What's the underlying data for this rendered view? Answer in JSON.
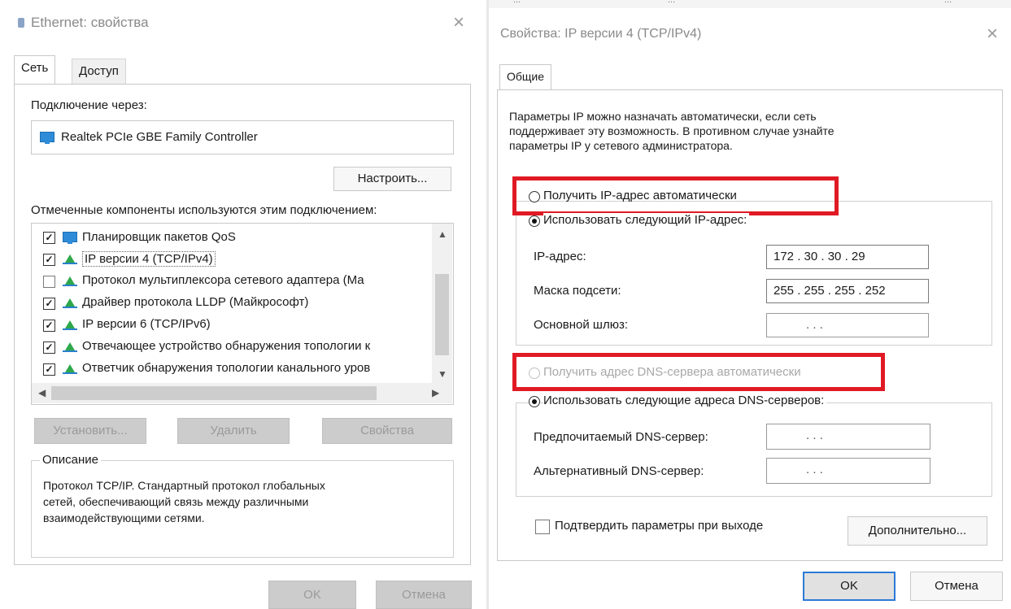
{
  "top_strip": {
    "items": [
      "...",
      "...",
      "..."
    ]
  },
  "left_dialog": {
    "title": "Ethernet: свойства",
    "close": "×",
    "tabs": [
      {
        "label": "Сеть",
        "active": true
      },
      {
        "label": "Доступ",
        "active": false
      }
    ],
    "connect_via_label": "Подключение через:",
    "adapter_name": "Realtek PCIe GBE Family Controller",
    "configure_button": "Настроить...",
    "components_label": "Отмеченные компоненты используются этим подключением:",
    "components": [
      {
        "label": "Планировщик пакетов QoS",
        "checked": true,
        "icon": "network-icon"
      },
      {
        "label": "IP версии 4 (TCP/IPv4)",
        "checked": true,
        "icon": "protocol-icon"
      },
      {
        "label": "Протокол мультиплексора сетевого адаптера (Ма",
        "checked": false,
        "icon": "protocol-icon"
      },
      {
        "label": "Драйвер протокола LLDP (Майкрософт)",
        "checked": true,
        "icon": "protocol-icon"
      },
      {
        "label": "IP версии 6 (TCP/IPv6)",
        "checked": true,
        "icon": "protocol-icon"
      },
      {
        "label": "Отвечающее устройство обнаружения топологии к",
        "checked": true,
        "icon": "protocol-icon"
      },
      {
        "label": "Ответчик обнаружения топологии канального уров",
        "checked": true,
        "icon": "protocol-icon"
      }
    ],
    "install_button": "Установить...",
    "remove_button": "Удалить",
    "properties_button": "Свойства",
    "description_legend": "Описание",
    "description_text_1": "Протокол TCP/IP. Стандартный протокол глобальных",
    "description_text_2": "сетей, обеспечивающий связь между различными",
    "description_text_3": "взаимодействующими сетями.",
    "ok_button": "OK",
    "cancel_button": "Отмена"
  },
  "right_dialog": {
    "title": "Свойства: IP версии 4 (TCP/IPv4)",
    "close": "×",
    "tab": "Общие",
    "intro_1": "Параметры IP можно назначать автоматически, если сеть",
    "intro_2": "поддерживает эту возможность. В противном случае узнайте",
    "intro_3": "параметры IP у сетевого администратора.",
    "radio_auto_ip": "Получить IP-адрес автоматически",
    "radio_manual_ip": "Использовать следующий IP-адрес:",
    "ip_label": "IP-адрес:",
    "ip_value": "172 . 30 . 30 . 29",
    "mask_label": "Маска подсети:",
    "mask_value": "255 . 255 . 255 . 252",
    "gateway_label": "Основной шлюз:",
    "gateway_value": ".   .   .",
    "radio_auto_dns": "Получить адрес DNS-сервера автоматически",
    "radio_manual_dns": "Использовать следующие адреса DNS-серверов:",
    "dns_pref_label": "Предпочитаемый DNS-сервер:",
    "dns_pref_value": ".   .   .",
    "dns_alt_label": "Альтернативный DNS-сервер:",
    "dns_alt_value": ".   .   .",
    "validate_label": "Подтвердить параметры при выходе",
    "advanced_button": "Дополнительно...",
    "ok_button": "OK",
    "cancel_button": "Отмена"
  },
  "colors": {
    "highlight_frame": "#e01a24",
    "focus_border": "#2c7ad6"
  }
}
